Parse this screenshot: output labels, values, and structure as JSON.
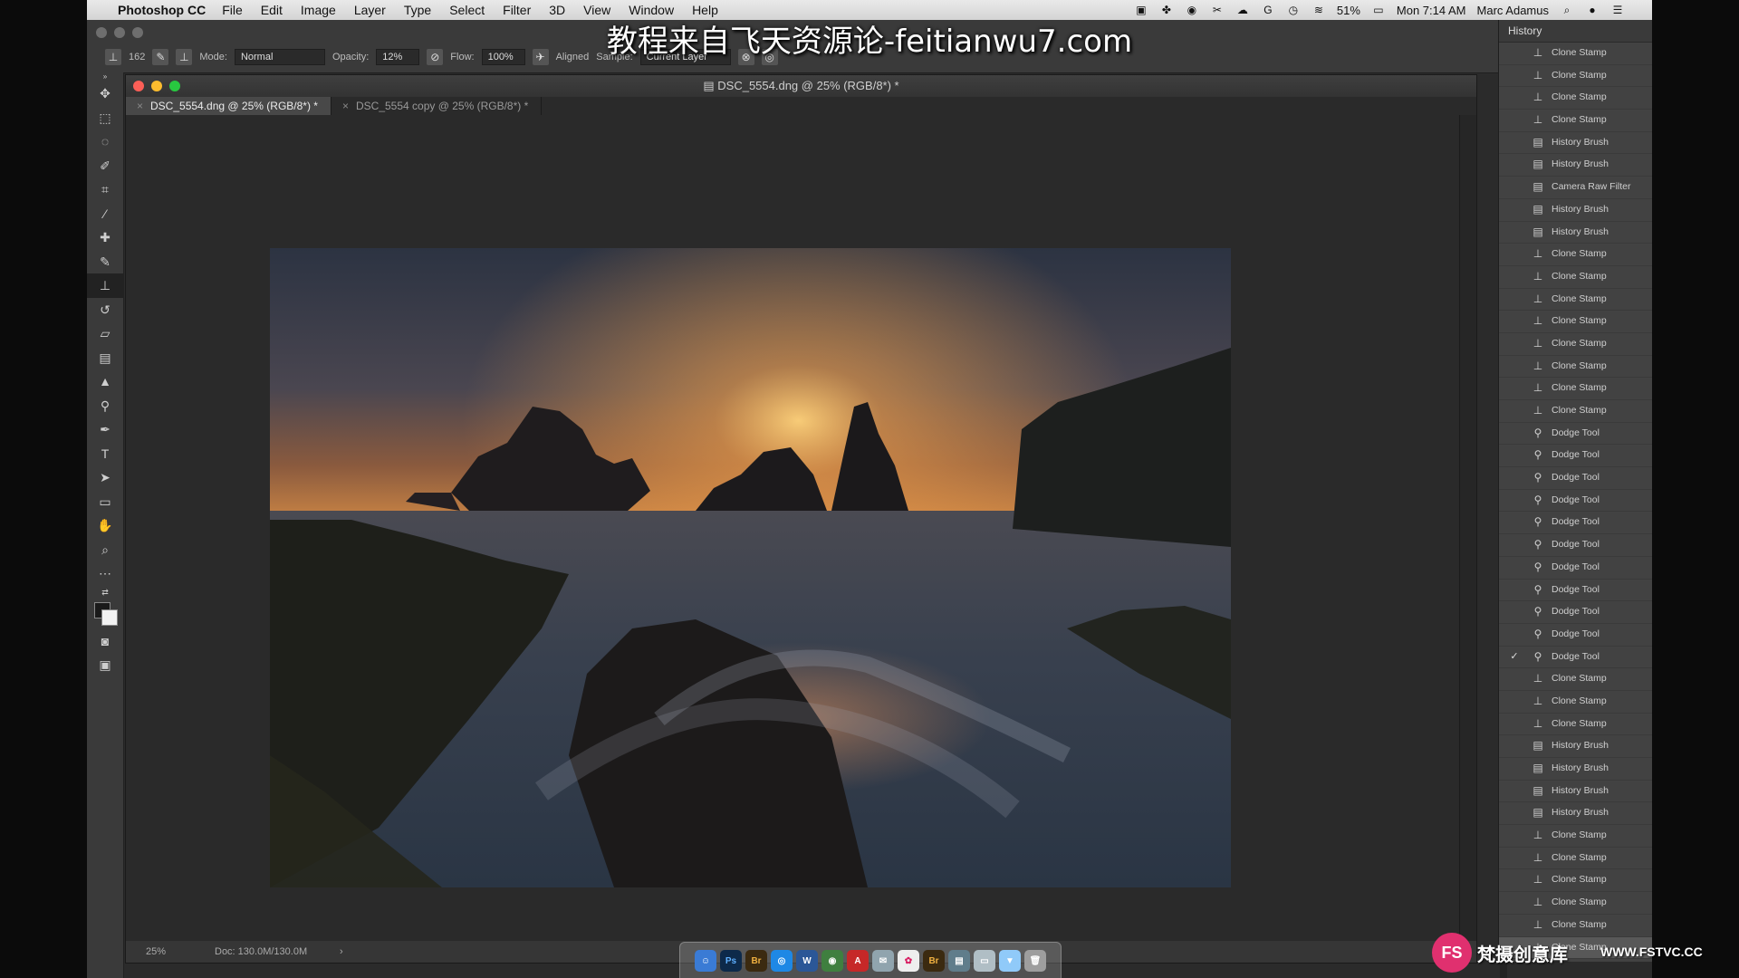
{
  "menubar": {
    "app_name": "Photoshop CC",
    "menus": [
      "File",
      "Edit",
      "Image",
      "Layer",
      "Type",
      "Select",
      "Filter",
      "3D",
      "View",
      "Window",
      "Help"
    ],
    "battery": "51%",
    "clock": "Mon 7:14 AM",
    "user": "Marc Adamus"
  },
  "watermark": "教程来自飞天资源论-feitianwu7.com",
  "options": {
    "brush_size": "162",
    "mode_label": "Mode:",
    "mode_value": "Normal",
    "opacity_label": "Opacity:",
    "opacity_value": "12%",
    "flow_label": "Flow:",
    "flow_value": "100%",
    "aligned_label": "Aligned",
    "sample_label": "Sample:",
    "sample_value": "Current Layer"
  },
  "document": {
    "title": "DSC_5554.dng @ 25% (RGB/8*) *",
    "tabs": [
      {
        "label": "DSC_5554.dng @ 25% (RGB/8*) *",
        "active": true
      },
      {
        "label": "DSC_5554 copy @ 25% (RGB/8*) *",
        "active": false
      }
    ],
    "zoom": "25%",
    "doc_info": "Doc: 130.0M/130.0M"
  },
  "history": {
    "title": "History",
    "items": [
      {
        "label": "Clone Stamp",
        "icon": "clone-stamp-icon"
      },
      {
        "label": "Clone Stamp",
        "icon": "clone-stamp-icon"
      },
      {
        "label": "Clone Stamp",
        "icon": "clone-stamp-icon"
      },
      {
        "label": "Clone Stamp",
        "icon": "clone-stamp-icon"
      },
      {
        "label": "History Brush",
        "icon": "history-brush-icon"
      },
      {
        "label": "History Brush",
        "icon": "history-brush-icon"
      },
      {
        "label": "Camera Raw Filter",
        "icon": "filter-icon"
      },
      {
        "label": "History Brush",
        "icon": "history-brush-icon"
      },
      {
        "label": "History Brush",
        "icon": "history-brush-icon"
      },
      {
        "label": "Clone Stamp",
        "icon": "clone-stamp-icon"
      },
      {
        "label": "Clone Stamp",
        "icon": "clone-stamp-icon"
      },
      {
        "label": "Clone Stamp",
        "icon": "clone-stamp-icon"
      },
      {
        "label": "Clone Stamp",
        "icon": "clone-stamp-icon"
      },
      {
        "label": "Clone Stamp",
        "icon": "clone-stamp-icon"
      },
      {
        "label": "Clone Stamp",
        "icon": "clone-stamp-icon"
      },
      {
        "label": "Clone Stamp",
        "icon": "clone-stamp-icon"
      },
      {
        "label": "Clone Stamp",
        "icon": "clone-stamp-icon"
      },
      {
        "label": "Dodge Tool",
        "icon": "dodge-tool-icon"
      },
      {
        "label": "Dodge Tool",
        "icon": "dodge-tool-icon"
      },
      {
        "label": "Dodge Tool",
        "icon": "dodge-tool-icon"
      },
      {
        "label": "Dodge Tool",
        "icon": "dodge-tool-icon"
      },
      {
        "label": "Dodge Tool",
        "icon": "dodge-tool-icon"
      },
      {
        "label": "Dodge Tool",
        "icon": "dodge-tool-icon"
      },
      {
        "label": "Dodge Tool",
        "icon": "dodge-tool-icon"
      },
      {
        "label": "Dodge Tool",
        "icon": "dodge-tool-icon"
      },
      {
        "label": "Dodge Tool",
        "icon": "dodge-tool-icon"
      },
      {
        "label": "Dodge Tool",
        "icon": "dodge-tool-icon"
      },
      {
        "label": "Dodge Tool",
        "icon": "dodge-tool-icon",
        "checked": true
      },
      {
        "label": "Clone Stamp",
        "icon": "clone-stamp-icon"
      },
      {
        "label": "Clone Stamp",
        "icon": "clone-stamp-icon"
      },
      {
        "label": "Clone Stamp",
        "icon": "clone-stamp-icon"
      },
      {
        "label": "History Brush",
        "icon": "history-brush-icon"
      },
      {
        "label": "History Brush",
        "icon": "history-brush-icon"
      },
      {
        "label": "History Brush",
        "icon": "history-brush-icon"
      },
      {
        "label": "History Brush",
        "icon": "history-brush-icon"
      },
      {
        "label": "Clone Stamp",
        "icon": "clone-stamp-icon"
      },
      {
        "label": "Clone Stamp",
        "icon": "clone-stamp-icon"
      },
      {
        "label": "Clone Stamp",
        "icon": "clone-stamp-icon"
      },
      {
        "label": "Clone Stamp",
        "icon": "clone-stamp-icon"
      },
      {
        "label": "Clone Stamp",
        "icon": "clone-stamp-icon"
      },
      {
        "label": "Clone Stamp",
        "icon": "clone-stamp-icon",
        "selected": true
      }
    ]
  },
  "brand": {
    "logo_text": "FS",
    "name": "梵摄创意库",
    "url": "WWW.FSTVC.CC"
  },
  "dock_apps": [
    "Finder",
    "Ps",
    "Br",
    "Safari",
    "Word",
    "Chrome",
    "Acrobat",
    "Mail",
    "Photos",
    "Br",
    "Preview",
    "Files",
    "Folder",
    "Trash"
  ]
}
